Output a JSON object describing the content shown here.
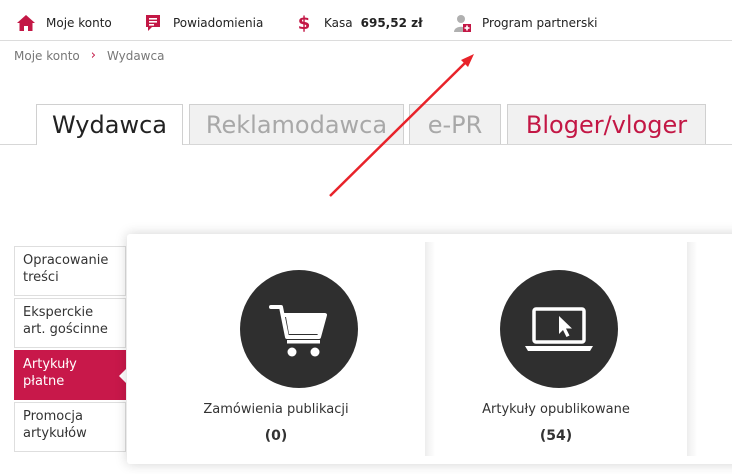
{
  "topbar": {
    "account_label": "Moje konto",
    "notifications_label": "Powiadomienia",
    "kasa_label": "Kasa",
    "kasa_amount": "695,52 zł",
    "partner_label": "Program partnerski"
  },
  "breadcrumb": {
    "home": "Moje konto",
    "current": "Wydawca"
  },
  "tabs": [
    {
      "label": "Wydawca",
      "active": true
    },
    {
      "label": "Reklamodawca",
      "active": false
    },
    {
      "label": "e-PR",
      "active": false
    },
    {
      "label": "Bloger/vloger",
      "active": false
    }
  ],
  "sidebar": {
    "items": [
      {
        "label": "Opracowanie treści"
      },
      {
        "label": "Eksperckie art. gościnne"
      },
      {
        "label": "Artykuły płatne",
        "active": true
      },
      {
        "label": "Promocja artykułów"
      }
    ]
  },
  "cards": [
    {
      "label": "Zamówienia publikacji",
      "count": "(0)",
      "icon": "cart-icon"
    },
    {
      "label": "Artykuły opublikowane",
      "count": "(54)",
      "icon": "laptop-cursor-icon"
    }
  ],
  "colors": {
    "accent": "#c8184a",
    "icon_bg": "#2f2f2f",
    "annotation_arrow": "#e8232a"
  }
}
